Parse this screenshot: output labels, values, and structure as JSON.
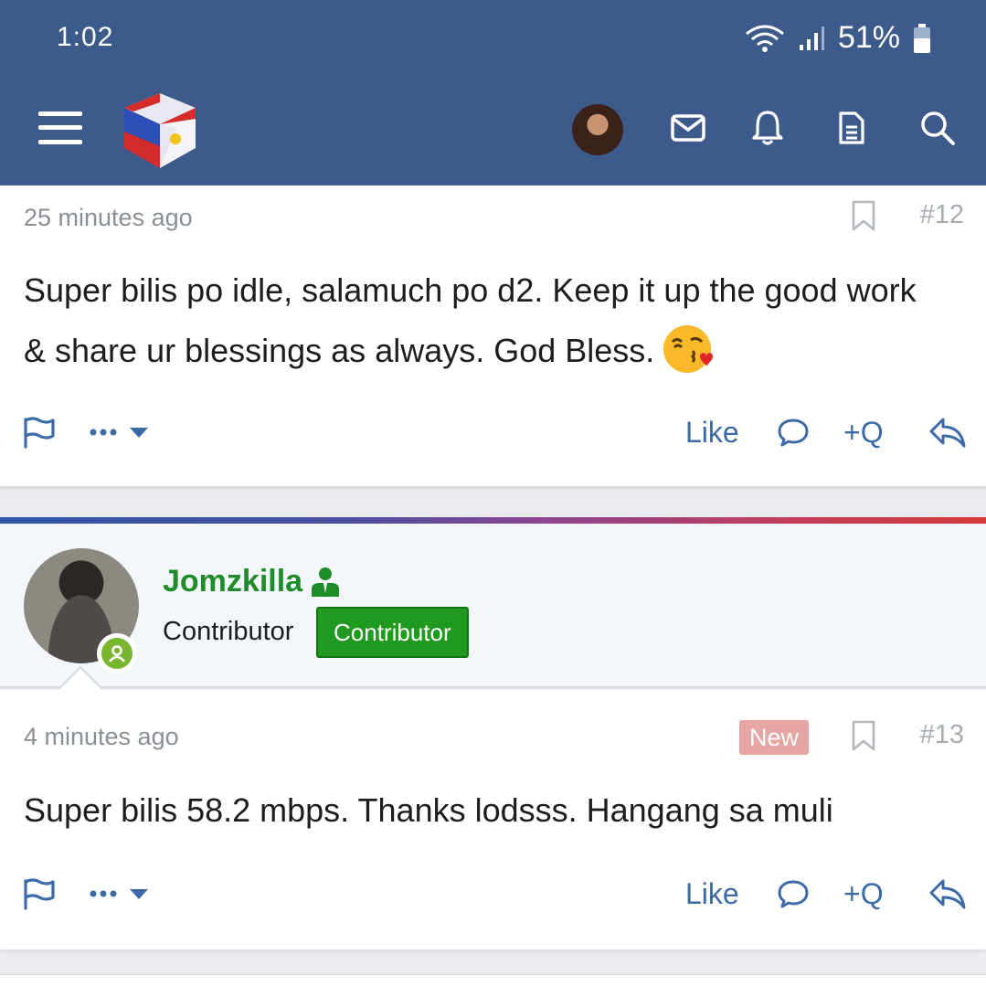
{
  "status_bar": {
    "time": "1:02",
    "battery": "51%"
  },
  "header": {
    "icons": [
      "menu-icon",
      "logo",
      "avatar",
      "mail-icon",
      "bell-icon",
      "document-icon",
      "search-icon"
    ],
    "color": "#3c5a8a"
  },
  "posts": [
    {
      "time": "25 minutes ago",
      "number": "#12",
      "text": "Super bilis po idle, salamuch po d2. Keep it up the good work & share ur blessings as always. God Bless.",
      "emoji": "face-blowing-kiss",
      "actions": {
        "like": "Like",
        "quote": "+Q"
      }
    },
    {
      "author": "Jomzkilla",
      "user_title": "Contributor",
      "badge": "Contributor",
      "time": "4 minutes ago",
      "new_label": "New",
      "number": "#13",
      "text": "Super bilis 58.2 mbps. Thanks lodsss. Hangang sa muli",
      "actions": {
        "like": "Like",
        "quote": "+Q"
      }
    }
  ],
  "colors": {
    "accent": "#3c6aa6",
    "username": "#1f8c2a",
    "badge": "#1f9a1f",
    "new_badge": "#e6a6a4",
    "online": "#7ab730"
  }
}
